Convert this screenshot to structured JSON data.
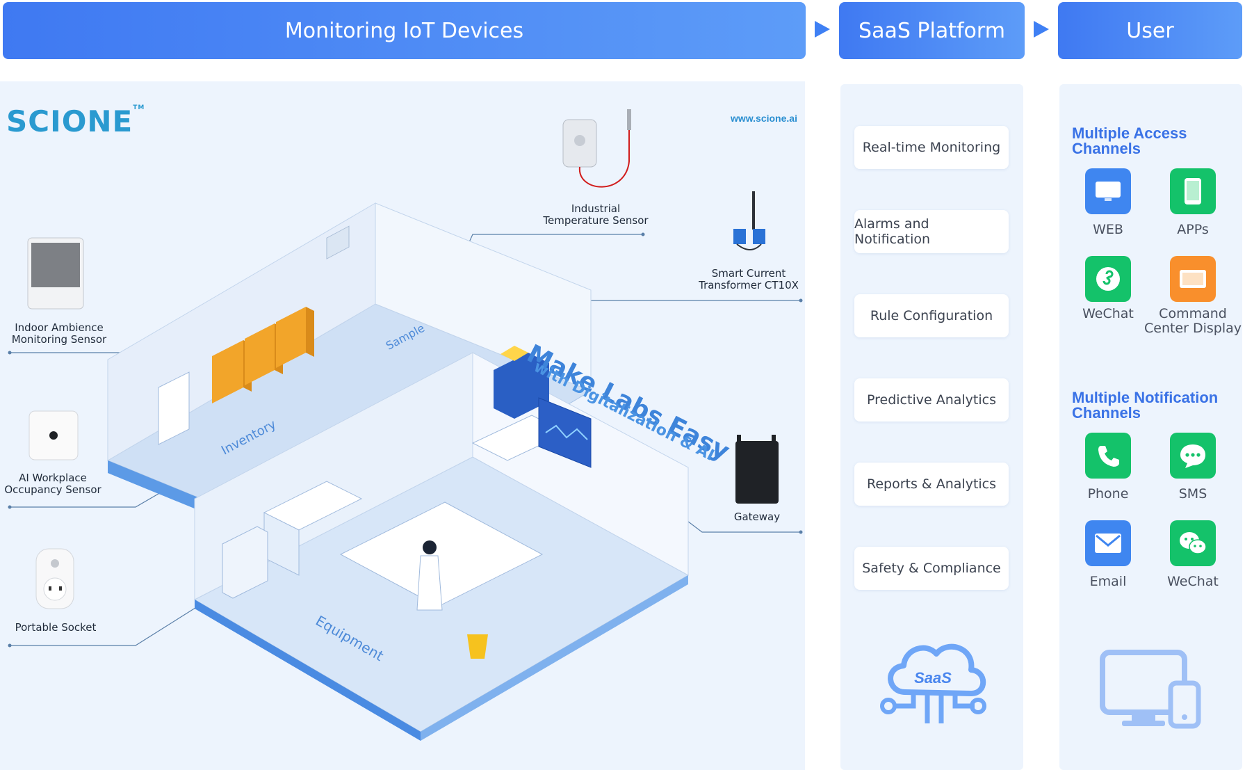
{
  "banners": {
    "iot": "Monitoring IoT Devices",
    "saas": "SaaS Platform",
    "user": "User"
  },
  "brand": {
    "logo": "SCIONE",
    "tm": "TM",
    "url": "www.scione.ai"
  },
  "devices": {
    "industrial_temp": [
      "Industrial",
      "Temperature Sensor"
    ],
    "ct10x": [
      "Smart Current",
      "Transformer CT10X"
    ],
    "indoor": [
      "Indoor Ambience",
      "Monitoring Sensor"
    ],
    "occupancy": [
      "AI Workplace",
      "Occupancy Sensor"
    ],
    "socket": [
      "Portable Socket"
    ],
    "gateway": [
      "Gateway"
    ]
  },
  "lab": {
    "slogan1": "Make Labs Easy",
    "slogan2": "with Digitalization & AI",
    "zones": {
      "sample": "Sample",
      "inventory": "Inventory",
      "equipment": "Equipment"
    }
  },
  "saas_features": [
    "Real-time Monitoring",
    "Alarms and Notification",
    "Rule Configuration",
    "Predictive Analytics",
    "Reports & Analytics",
    "Safety & Compliance"
  ],
  "saas_cloud_label": "SaaS",
  "access": {
    "title1": "Multiple Access",
    "title2": "Channels",
    "items": [
      {
        "label": "WEB",
        "icon": "monitor-icon",
        "color": "#3f86f0"
      },
      {
        "label": "APPs",
        "icon": "phone-app-icon",
        "color": "#14c26a"
      },
      {
        "label": "WeChat",
        "icon": "miniprogram-icon",
        "color": "#14c26a"
      },
      {
        "label": "Command Center Display",
        "icon": "display-icon",
        "color": "#f98f2c"
      }
    ]
  },
  "notify": {
    "title1": "Multiple Notification",
    "title2": "Channels",
    "items": [
      {
        "label": "Phone",
        "icon": "phone-icon",
        "color": "#14c26a"
      },
      {
        "label": "SMS",
        "icon": "sms-icon",
        "color": "#14c26a"
      },
      {
        "label": "Email",
        "icon": "email-icon",
        "color": "#3f86f0"
      },
      {
        "label": "WeChat",
        "icon": "wechat-icon",
        "color": "#14c26a"
      }
    ]
  }
}
